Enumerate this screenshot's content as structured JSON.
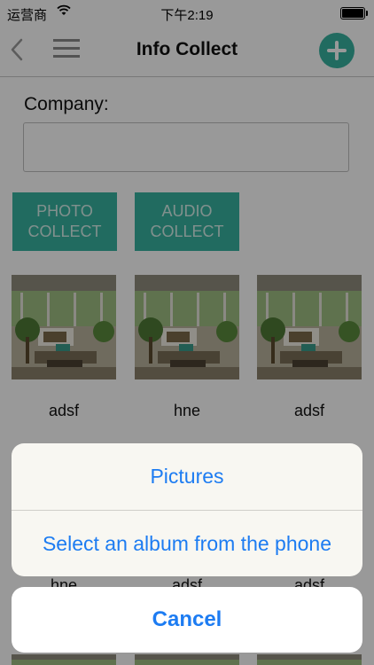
{
  "status_bar": {
    "carrier": "运营商",
    "time": "下午2:19"
  },
  "nav": {
    "title": "Info Collect"
  },
  "form": {
    "company_label": "Company:",
    "company_value": ""
  },
  "buttons": {
    "photo": "PHOTO\nCOLLECT",
    "audio": "AUDIO\nCOLLECT"
  },
  "gallery": {
    "row1": [
      "adsf",
      "hne",
      "adsf"
    ],
    "row2": [
      "hne",
      "adsf",
      "adsf"
    ]
  },
  "action_sheet": {
    "option_pictures": "Pictures",
    "option_album": "Select an album from the phone",
    "cancel": "Cancel"
  },
  "colors": {
    "accent": "#37b3a0",
    "ios_blue": "#1d7cf2"
  }
}
